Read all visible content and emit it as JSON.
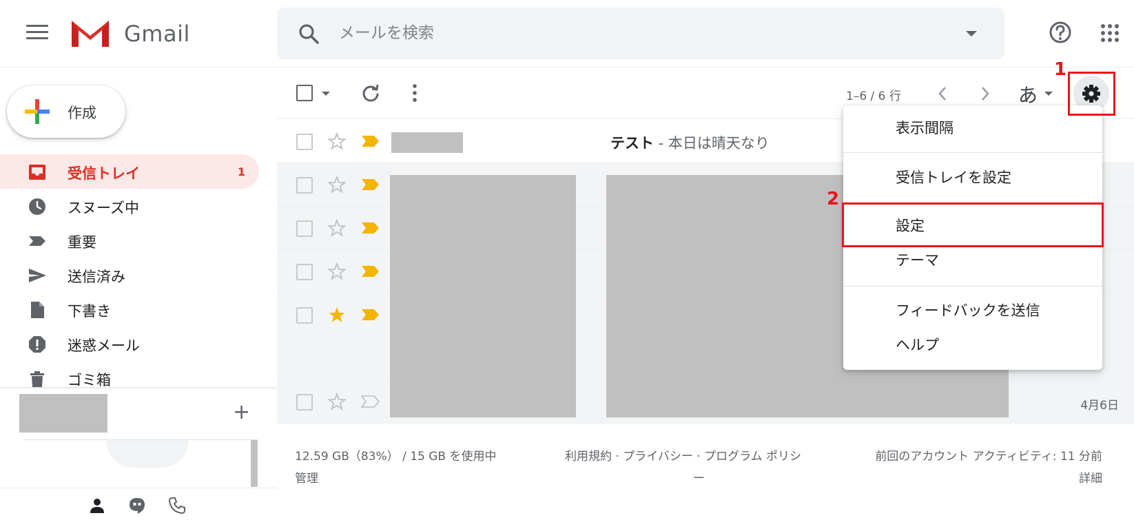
{
  "header": {
    "app_name": "Gmail",
    "search_placeholder": "メールを検索"
  },
  "sidebar": {
    "compose_label": "作成",
    "items": [
      {
        "label": "受信トレイ",
        "count": "1",
        "icon": "inbox-icon"
      },
      {
        "label": "スヌーズ中",
        "icon": "clock-icon"
      },
      {
        "label": "重要",
        "icon": "label-important-icon"
      },
      {
        "label": "送信済み",
        "icon": "send-icon"
      },
      {
        "label": "下書き",
        "icon": "draft-icon"
      },
      {
        "label": "迷惑メール",
        "icon": "spam-icon"
      },
      {
        "label": "ゴミ箱",
        "icon": "trash-icon"
      }
    ],
    "add_label": "+"
  },
  "toolbar": {
    "page_info": "1–6 / 6 行",
    "input_method": "あ"
  },
  "annotations": {
    "step1": "1",
    "step2": "2",
    "highlight_color": "#e8141b"
  },
  "rows": [
    {
      "subject": "テスト",
      "snippet": " - 本日は晴天なり",
      "starred": false,
      "important": true
    },
    {
      "starred": false,
      "important": true
    },
    {
      "starred": false,
      "important": true
    },
    {
      "starred": false,
      "important": true
    },
    {
      "starred": true,
      "important": true
    },
    {
      "starred": false,
      "important": false,
      "date": "4月6日"
    }
  ],
  "menu": {
    "items": [
      "表示間隔",
      "受信トレイを設定",
      "設定",
      "テーマ",
      "フィードバックを送信",
      "ヘルプ"
    ]
  },
  "footer": {
    "storage": "12.59 GB（83%） / 15 GB を使用中",
    "manage": "管理",
    "links": "利用規約 · プライバシー · プログラム ポリシ",
    "links_cont": "ー",
    "activity": "前回のアカウント アクティビティ: 11 分前",
    "details": "詳細"
  },
  "colors": {
    "accent_red": "#d93025",
    "inbox_bg": "#fce8e6",
    "important_yellow": "#f4b400",
    "redacted_gray": "#c0c0c0"
  }
}
